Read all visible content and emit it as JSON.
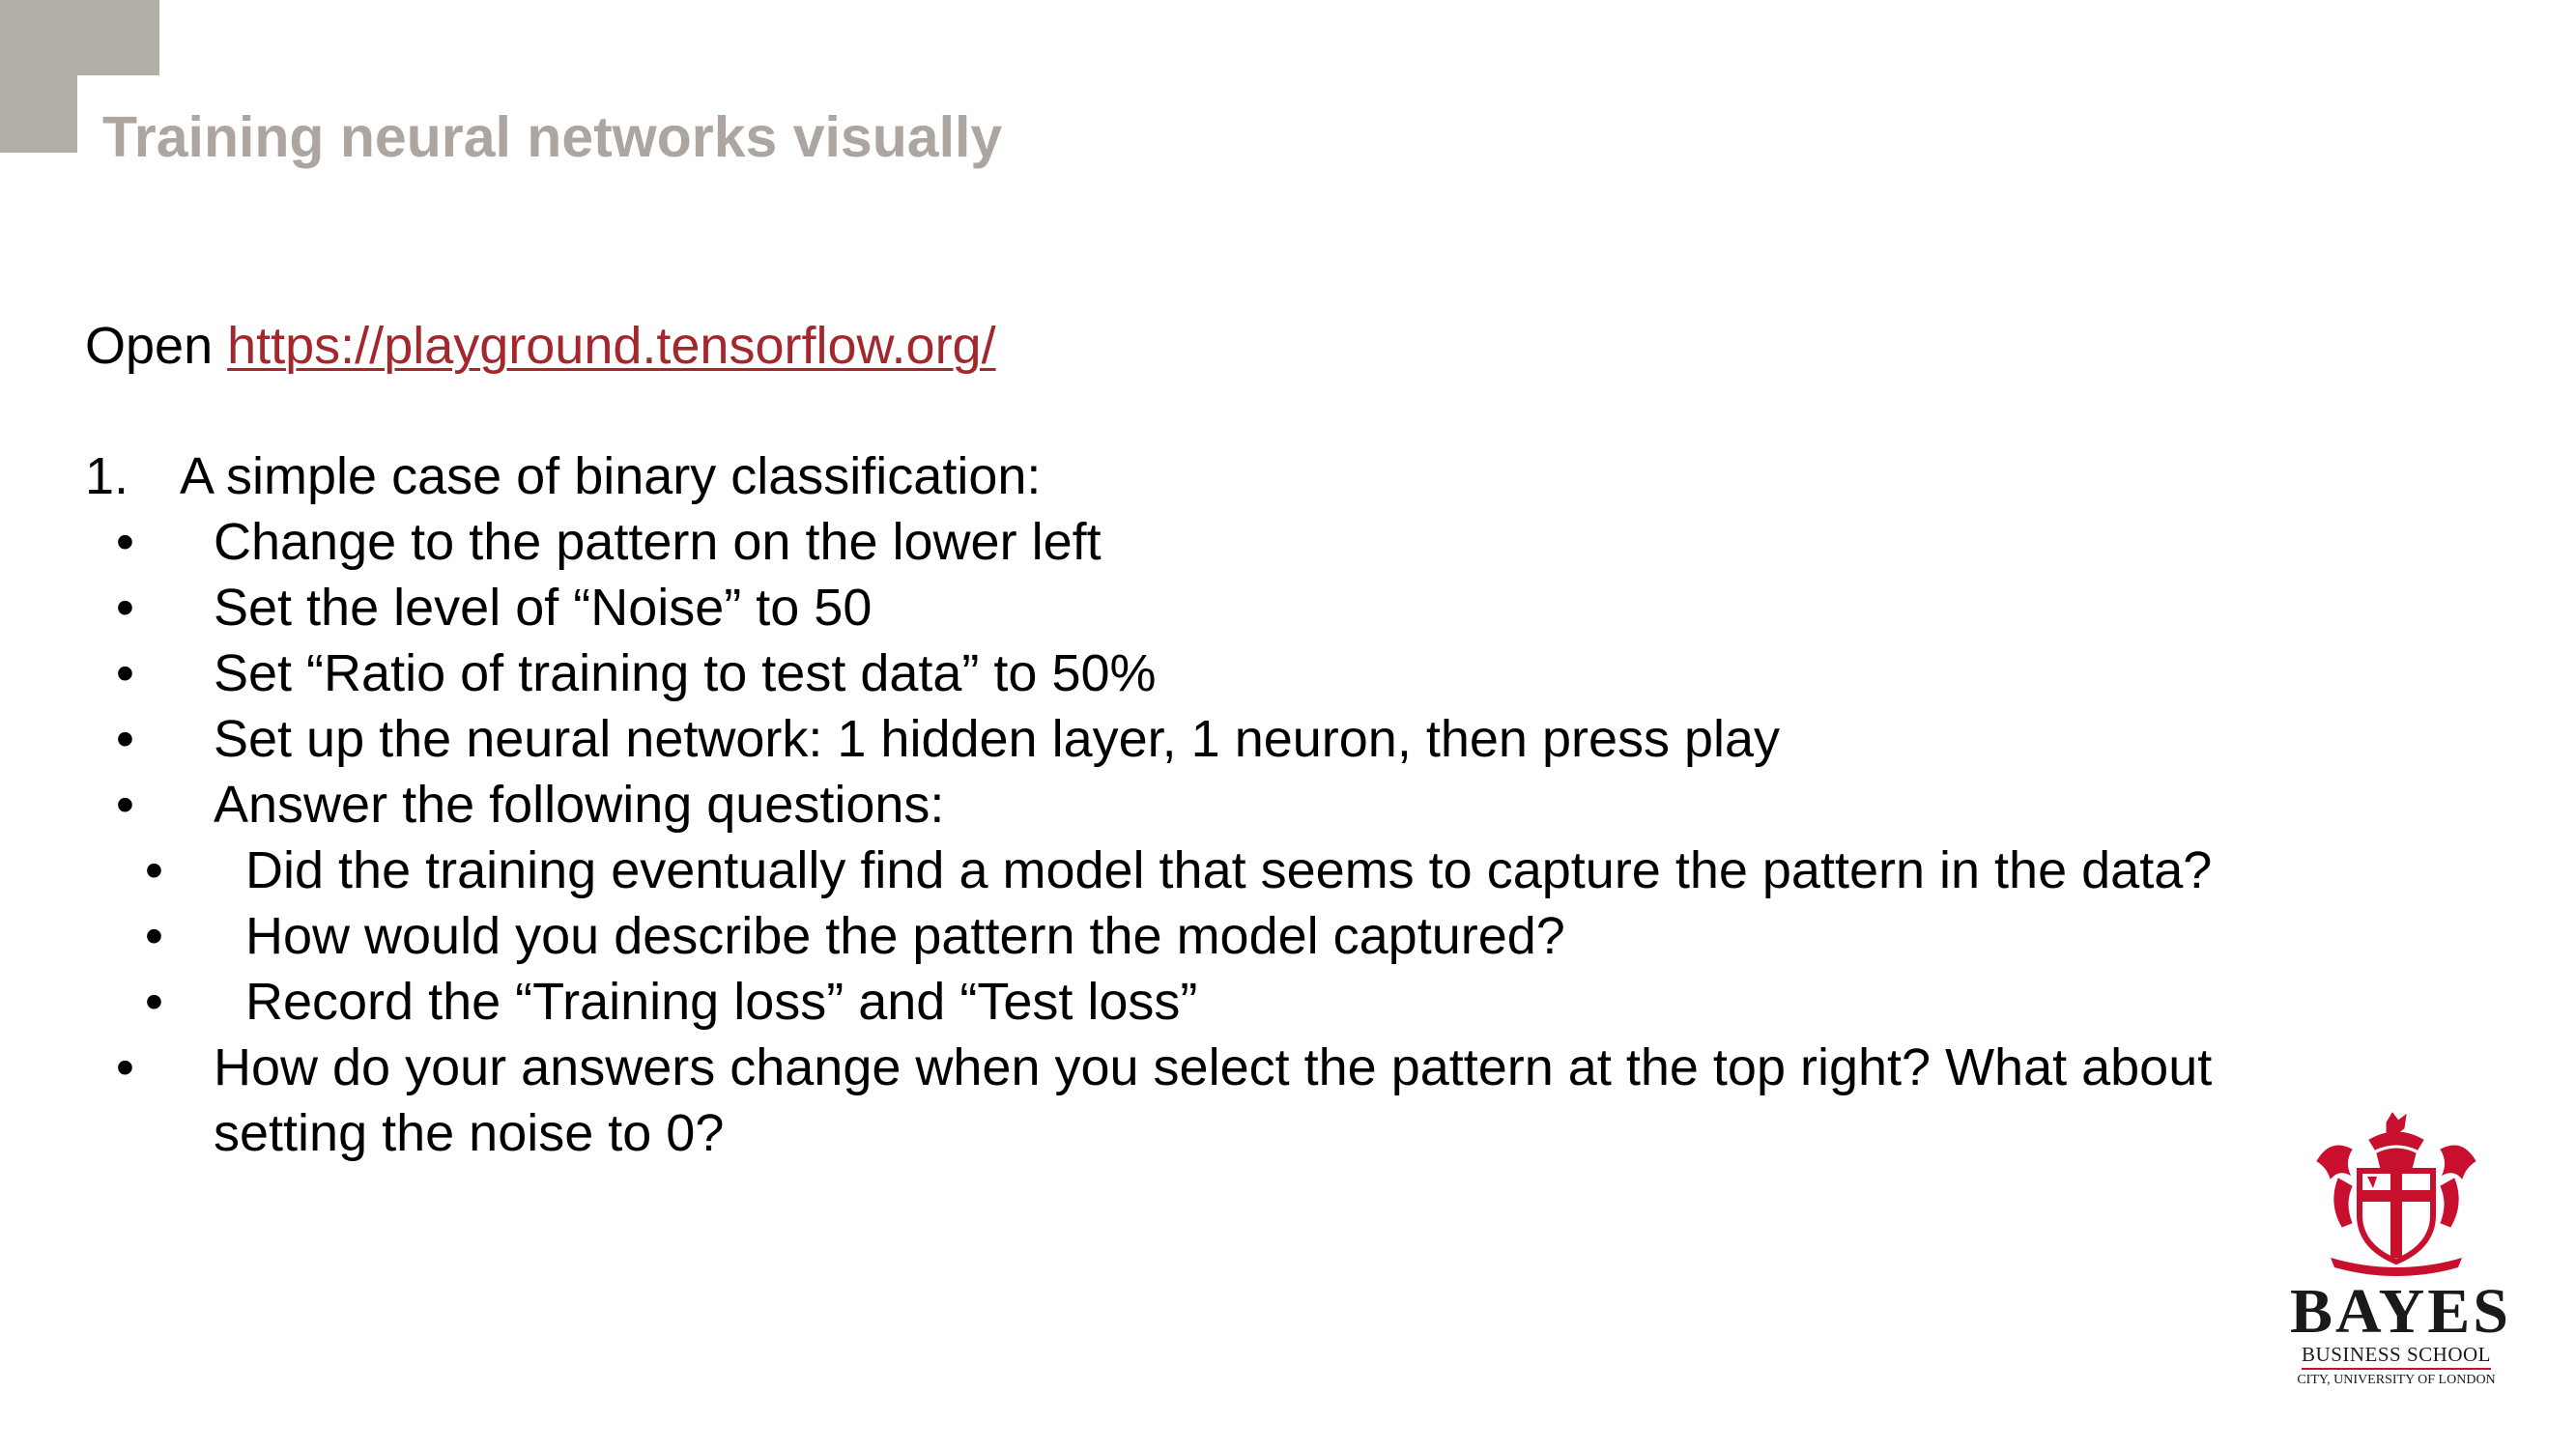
{
  "slide": {
    "title": "Training neural networks visually",
    "open_prefix": "Open ",
    "open_link": "https://playground.tensorflow.org/",
    "item_number": "1.",
    "item_text": "A simple case of binary classification:",
    "bullet_char": "•",
    "bullets": [
      "Change to the pattern on the lower left",
      "Set the level of “Noise” to 50",
      "Set “Ratio of training to test data” to 50%",
      "Set up the neural network: 1 hidden layer, 1 neuron, then press play",
      "Answer the following questions:"
    ],
    "sub_bullets": [
      "Did the training eventually find a model that seems to capture the pattern in the data?",
      "How would you describe the pattern the model captured?",
      "Record the “Training loss” and “Test loss”"
    ],
    "last_bullet_line1": "How do your answers change when you select the pattern at the top right? What about",
    "last_bullet_line2": "setting the noise to 0?"
  },
  "logo": {
    "name": "BAYES",
    "subtitle": "BUSINESS SCHOOL",
    "subtitle2": "CITY, UNIVERSITY OF LONDON",
    "color": "#c8102e"
  },
  "colors": {
    "title": "#aca5a0",
    "corner": "#b4aea9",
    "link": "#a3282e"
  }
}
